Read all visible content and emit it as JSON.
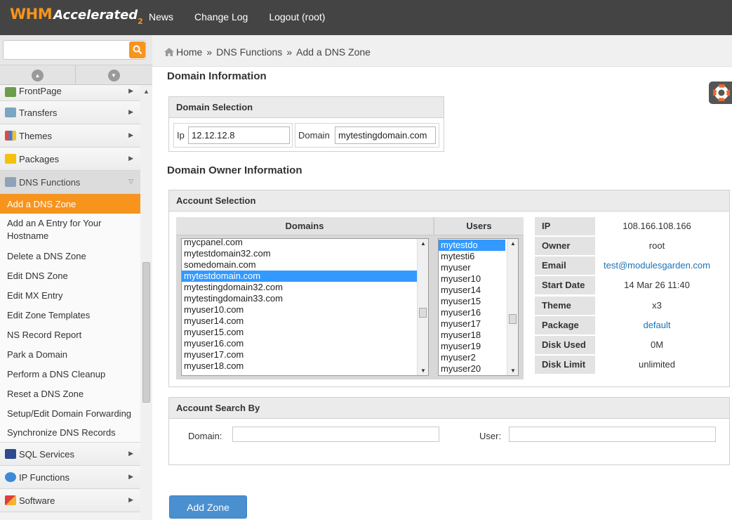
{
  "header": {
    "logo": {
      "whm": "WHM",
      "accelerated": "Accelerated",
      "version": "2"
    },
    "nav": [
      {
        "label": "News"
      },
      {
        "label": "Change Log"
      },
      {
        "label": "Logout (root)"
      }
    ]
  },
  "sidebar": {
    "search": {
      "value": "",
      "icon": "search-icon"
    },
    "menu_top": [
      {
        "label": "FrontPage",
        "icon": "frontpage-icon"
      },
      {
        "label": "Transfers",
        "icon": "transfers-icon"
      },
      {
        "label": "Themes",
        "icon": "themes-icon"
      },
      {
        "label": "Packages",
        "icon": "packages-icon"
      }
    ],
    "open_section": {
      "label": "DNS Functions",
      "icon": "dns-icon"
    },
    "sub_items": [
      {
        "label": "Add a DNS Zone",
        "active": true
      },
      {
        "label": "Add an A Entry for Your Hostname"
      },
      {
        "label": "Delete a DNS Zone"
      },
      {
        "label": "Edit DNS Zone"
      },
      {
        "label": "Edit MX Entry"
      },
      {
        "label": "Edit Zone Templates"
      },
      {
        "label": "NS Record Report"
      },
      {
        "label": "Park a Domain"
      },
      {
        "label": "Perform a DNS Cleanup"
      },
      {
        "label": "Reset a DNS Zone"
      },
      {
        "label": "Setup/Edit Domain Forwarding"
      },
      {
        "label": "Synchronize DNS Records"
      }
    ],
    "menu_bottom": [
      {
        "label": "SQL Services",
        "icon": "sql-icon"
      },
      {
        "label": "IP Functions",
        "icon": "ip-icon"
      },
      {
        "label": "Software",
        "icon": "software-icon"
      }
    ]
  },
  "breadcrumb": {
    "home": "Home",
    "section": "DNS Functions",
    "current": "Add a DNS Zone",
    "sep": "»"
  },
  "domain_info": {
    "title": "Domain Information",
    "panel_title": "Domain Selection",
    "ip_label": "Ip",
    "ip_value": "12.12.12.8",
    "domain_label": "Domain",
    "domain_value": "mytestingdomain.com"
  },
  "owner_info": {
    "title": "Domain Owner Information",
    "panel_title": "Account Selection",
    "domains_header": "Domains",
    "users_header": "Users",
    "domains": [
      "mycpanel.com",
      "mytestdomain32.com",
      "somedomain.com",
      "mytestdomain.com",
      "mytestingdomain32.com",
      "mytestingdomain33.com",
      "myuser10.com",
      "myuser14.com",
      "myuser15.com",
      "myuser16.com",
      "myuser17.com",
      "myuser18.com"
    ],
    "domains_selected": "mytestdomain.com",
    "users": [
      "mytestdo",
      "mytesti6",
      "myuser",
      "myuser10",
      "myuser14",
      "myuser15",
      "myuser16",
      "myuser17",
      "myuser18",
      "myuser19",
      "myuser2",
      "myuser20"
    ],
    "users_selected": "mytestdo",
    "details": [
      {
        "key": "IP",
        "value": "108.166.108.166",
        "link": false
      },
      {
        "key": "Owner",
        "value": "root",
        "link": false
      },
      {
        "key": "Email",
        "value": "test@modulesgarden.com",
        "link": true
      },
      {
        "key": "Start Date",
        "value": "14 Mar 26 11:40",
        "link": false
      },
      {
        "key": "Theme",
        "value": "x3",
        "link": false
      },
      {
        "key": "Package",
        "value": "default",
        "link": true
      },
      {
        "key": "Disk Used",
        "value": "0M",
        "link": false
      },
      {
        "key": "Disk Limit",
        "value": "unlimited",
        "link": false
      }
    ]
  },
  "account_search": {
    "panel_title": "Account Search By",
    "domain_label": "Domain:",
    "domain_value": "",
    "user_label": "User:",
    "user_value": ""
  },
  "actions": {
    "add_zone": "Add Zone"
  },
  "colors": {
    "accent": "#f7941d",
    "topbar": "#444444",
    "link": "#1a73b8",
    "button": "#4a90d0",
    "selection": "#3399ff"
  }
}
